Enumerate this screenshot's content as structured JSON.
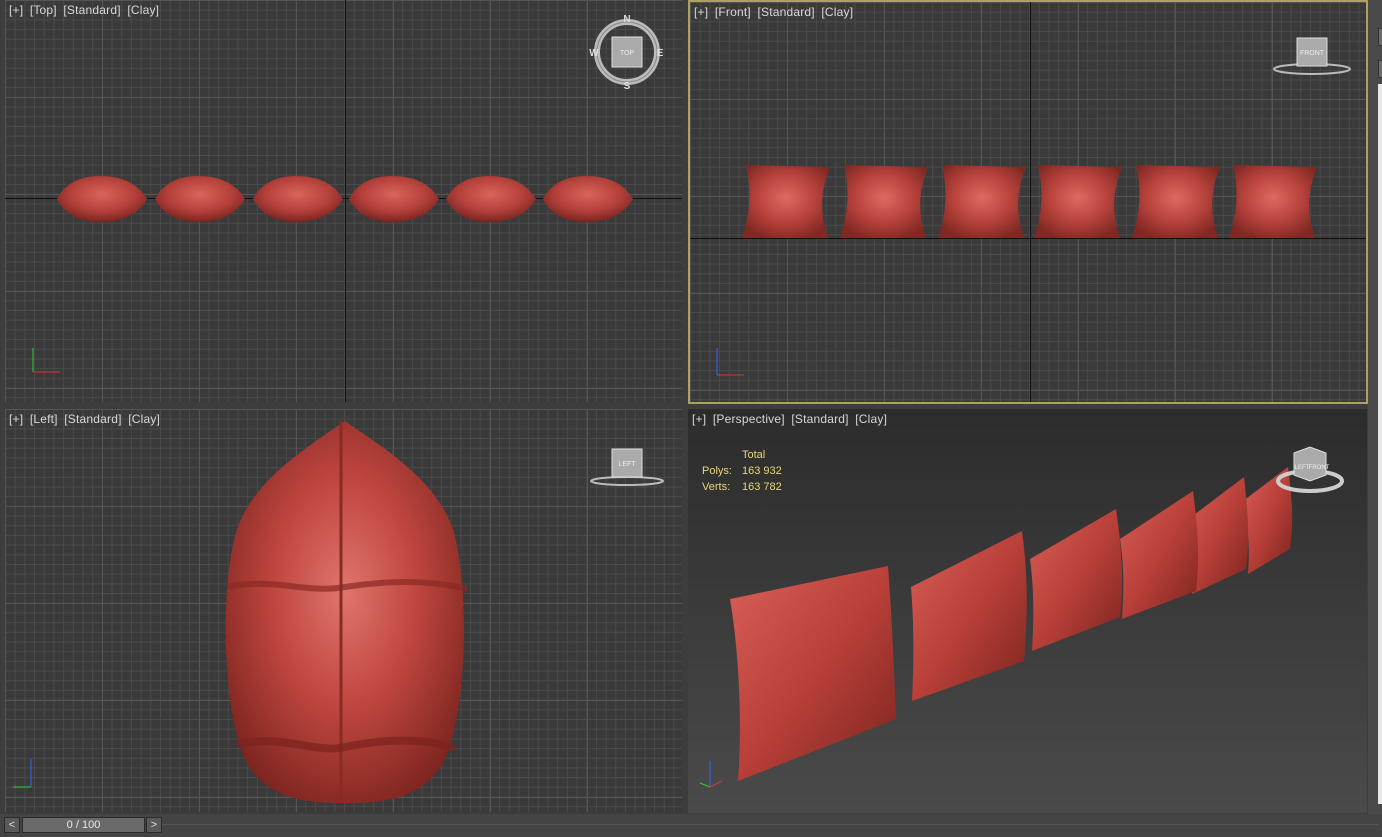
{
  "viewports": {
    "top": {
      "labels": [
        "[+]",
        "[Top]",
        "[Standard]",
        "[Clay]"
      ],
      "viewcube_face": "TOP",
      "compass": {
        "north": "N",
        "south": "S",
        "east": "E",
        "west": "W"
      }
    },
    "front": {
      "labels": [
        "[+]",
        "[Front]",
        "[Standard]",
        "[Clay]"
      ],
      "viewcube_face": "FRONT"
    },
    "left": {
      "labels": [
        "[+]",
        "[Left]",
        "[Standard]",
        "[Clay]"
      ],
      "viewcube_face": "LEFT"
    },
    "perspective": {
      "labels": [
        "[+]",
        "[Perspective]",
        "[Standard]",
        "[Clay]"
      ],
      "viewcube_face": "LEFT",
      "viewcube_face2": "FRONT"
    }
  },
  "stats": {
    "header": "Total",
    "polys_label": "Polys:",
    "polys_value": "163 932",
    "verts_label": "Verts:",
    "verts_value": "163 782"
  },
  "timeline": {
    "prev": "<",
    "next": ">",
    "frame": "0 / 100"
  },
  "axes": {
    "x": "x",
    "y": "y",
    "z": "z"
  },
  "colors": {
    "clay": "#b8403a",
    "active_border": "#b0a060",
    "axis_x": "#d33",
    "axis_y": "#3c3",
    "axis_z": "#36f"
  }
}
